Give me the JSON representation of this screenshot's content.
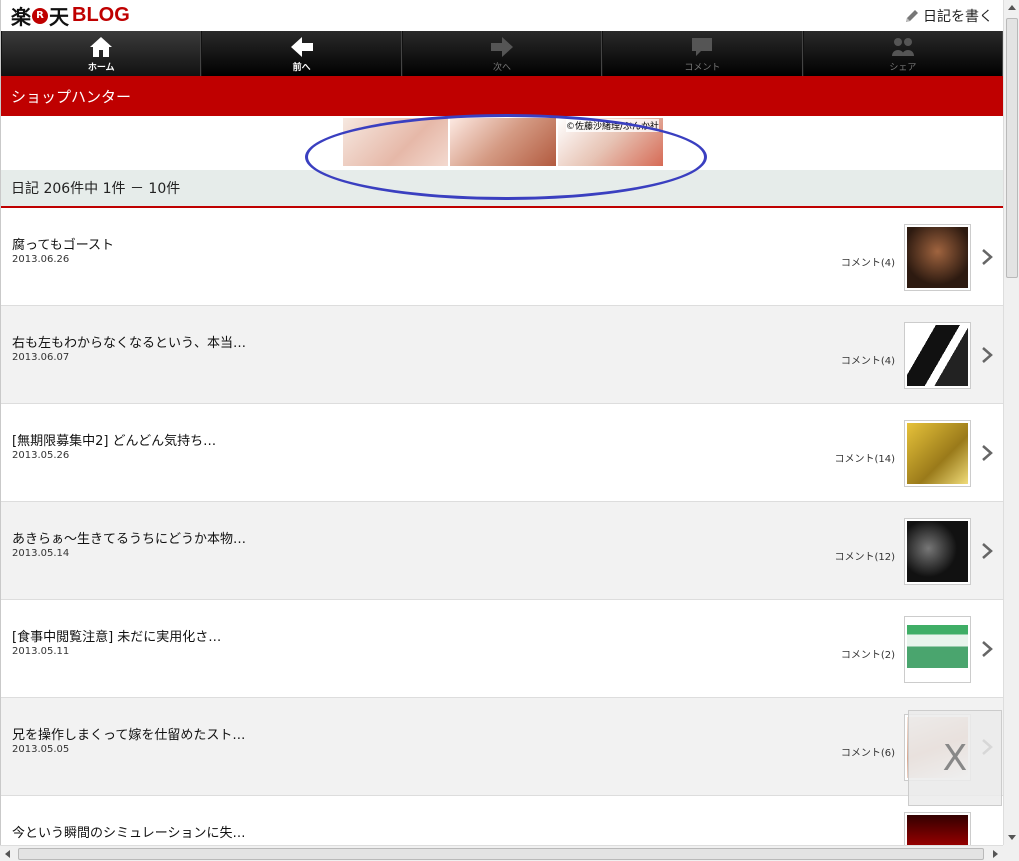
{
  "header": {
    "logo_raku": "楽",
    "logo_r": "R",
    "logo_ten": "天",
    "logo_blog": "BLOG",
    "write_label": "日記を書く"
  },
  "nav": {
    "items": [
      {
        "label": "ホーム",
        "icon": "home-icon",
        "state": "active"
      },
      {
        "label": "前へ",
        "icon": "arrow-left-icon",
        "state": "active"
      },
      {
        "label": "次へ",
        "icon": "arrow-right-icon",
        "state": "disabled"
      },
      {
        "label": "コメント",
        "icon": "comment-icon",
        "state": "disabled"
      },
      {
        "label": "シェア",
        "icon": "share-icon",
        "state": "disabled"
      }
    ]
  },
  "page_title": "ショップハンター",
  "ad": {
    "copyright": "©佐藤沙緒理/ぶんか社"
  },
  "count_text": "日記 206件中 1件 － 10件",
  "entries": [
    {
      "title": "腐ってもゴースト",
      "date": "2013.06.26",
      "comment": "コメント(4)"
    },
    {
      "title": "右も左もわからなくなるという、本当…",
      "date": "2013.06.07",
      "comment": "コメント(4)"
    },
    {
      "title": "[無期限募集中2] どんどん気持ち…",
      "date": "2013.05.26",
      "comment": "コメント(14)"
    },
    {
      "title": "あきらぁ～生きてるうちにどうか本物…",
      "date": "2013.05.14",
      "comment": "コメント(12)"
    },
    {
      "title": "[食事中閲覧注意] 未だに実用化さ…",
      "date": "2013.05.11",
      "comment": "コメント(2)"
    },
    {
      "title": "兄を操作しまくって嫁を仕留めたスト…",
      "date": "2013.05.05",
      "comment": "コメント(6)"
    },
    {
      "title": "今という瞬間のシミュレーションに失…",
      "date": "",
      "comment": ""
    }
  ],
  "overlay_close": "X",
  "colors": {
    "brand_red": "#bf0000",
    "highlight_oval": "#3a3fc0"
  }
}
